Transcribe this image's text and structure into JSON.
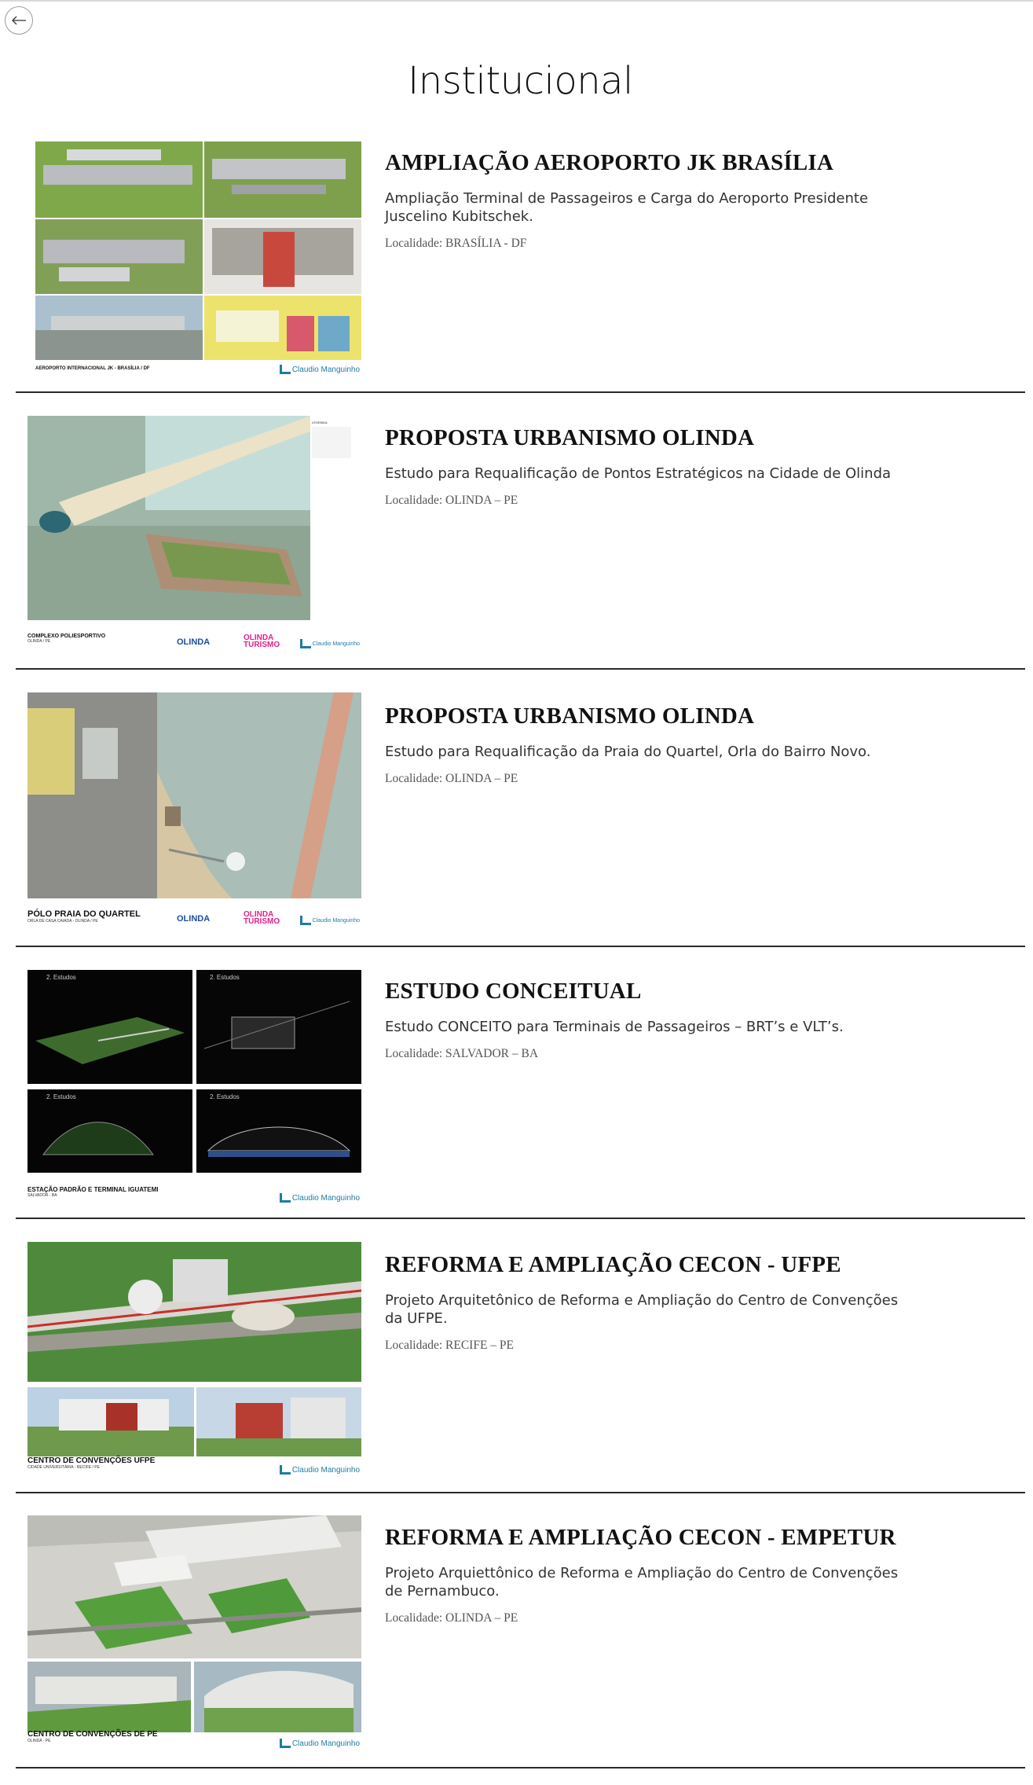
{
  "nav": {
    "back_icon": "arrow-left-icon"
  },
  "page_title": "Institucional",
  "projects": [
    {
      "title": "AMPLIAÇÃO AEROPORTO JK BRASÍLIA",
      "description": "Ampliação Terminal de Passageiros e Carga do Aeroporto Presidente Juscelino Kubitschek.",
      "location": "Localidade: BRASÍLIA - DF",
      "thumb_caption": "AEROPORTO INTERNACIONAL JK - BRASÍLIA / DF",
      "brand": "Claudio Manguinho"
    },
    {
      "title": "PROPOSTA URBANISMO OLINDA",
      "description": "Estudo para Requalificação de Pontos Estratégicos na Cidade de Olinda",
      "location": "Localidade: OLINDA – PE",
      "thumb_caption": "COMPLEXO POLIESPORTIVO",
      "thumb_sub": "OLINDA / PE",
      "logo_olinda": "OLINDA",
      "logo_turismo": "OLINDA TURISMO",
      "brand": "Claudio Manguinho"
    },
    {
      "title": "PROPOSTA URBANISMO OLINDA",
      "description": "Estudo para Requalificação da Praia do Quartel, Orla do Bairro Novo.",
      "location": "Localidade: OLINDA – PE",
      "thumb_caption": "PÓLO PRAIA DO QUARTEL",
      "thumb_sub": "ORLA DE CASA CAIADA - OLINDA / PE",
      "logo_olinda": "OLINDA",
      "logo_turismo": "OLINDA TURISMO",
      "brand": "Claudio Manguinho"
    },
    {
      "title": "ESTUDO CONCEITUAL",
      "description": "Estudo CONCEITO para Terminais de Passageiros – BRT’s e VLT’s.",
      "location": "Localidade: SALVADOR – BA",
      "thumb_caption": "ESTAÇÃO PADRÃO E TERMINAL IGUATEMI",
      "thumb_sub": "SALVADOR - BA",
      "brand": "Claudio Manguinho"
    },
    {
      "title": "REFORMA E AMPLIAÇÃO CECON - UFPE",
      "description": "Projeto Arquitetônico de Reforma e Ampliação do Centro de Convenções da UFPE.",
      "location": "Localidade: RECIFE – PE",
      "thumb_caption": "CENTRO DE CONVENÇÕES UFPE",
      "thumb_sub": "CIDADE UNIVERSITÁRIA - RECIFE / PE",
      "brand": "Claudio Manguinho"
    },
    {
      "title": "REFORMA E AMPLIAÇÃO CECON - EMPETUR",
      "description": "Projeto Arquiettônico de Reforma e Ampliação do Centro de Convenções de Pernambuco.",
      "location": "Localidade: OLINDA – PE",
      "thumb_caption": "CENTRO DE CONVENÇÕES DE PE",
      "thumb_sub": "OLINDA - PE",
      "brand": "Claudio Manguinho"
    }
  ]
}
